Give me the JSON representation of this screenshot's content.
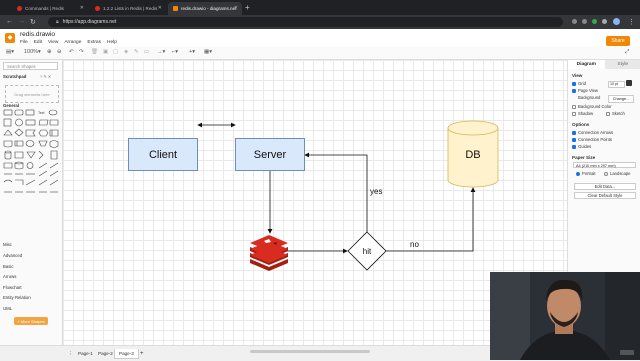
{
  "browser": {
    "tabs": [
      {
        "label": "Commands | Redis",
        "active": false
      },
      {
        "label": "1.2.2 Lists in Redis | Redis",
        "active": false
      },
      {
        "label": "redis.drawio - diagrams.net",
        "active": true
      }
    ],
    "url": "https://app.diagrams.net"
  },
  "app": {
    "title": "redis.drawio",
    "menu": [
      "File",
      "Edit",
      "View",
      "Arrange",
      "Extras",
      "Help"
    ],
    "share_label": "Share",
    "zoom": "100%"
  },
  "sidebar": {
    "search_placeholder": "Search Shapes",
    "scratchpad": "Scratchpad",
    "drag_hint": "Drag elements here",
    "general": "General",
    "libraries": [
      "Misc",
      "Advanced",
      "Basic",
      "Arrows",
      "Flowchart",
      "Entity Relation",
      "UML"
    ],
    "more_shapes": "+ More Shapes"
  },
  "diagram": {
    "client": "Client",
    "server": "Server",
    "db": "DB",
    "hit": "hit",
    "yes": "yes",
    "no": "no",
    "box_fill": "#dae8fc",
    "box_stroke": "#6c8ebf",
    "db_fill": "#fff2cc",
    "db_stroke": "#d6b656",
    "redis_color": "#c6302b"
  },
  "format_panel": {
    "tabs": [
      "Diagram",
      "Style"
    ],
    "view_header": "View",
    "grid": "Grid",
    "grid_size": "10 pt",
    "page_view": "Page View",
    "background": "Background",
    "change_button": "Change...",
    "background_color": "Background Color",
    "shadow": "Shadow",
    "sketch": "Sketch",
    "options_header": "Options",
    "connection_arrows": "Connection Arrows",
    "connection_points": "Connection Points",
    "guides": "Guides",
    "paper_size_header": "Paper Size",
    "paper_size": "A4 (210 mm x 297 mm)",
    "portrait": "Portrait",
    "landscape": "Landscape",
    "edit_data_button": "Edit Data...",
    "clear_style_button": "Clear Default Style"
  },
  "pages": {
    "tabs": [
      "Page-1",
      "Page-2",
      "Page-3"
    ],
    "active_index": 2
  }
}
